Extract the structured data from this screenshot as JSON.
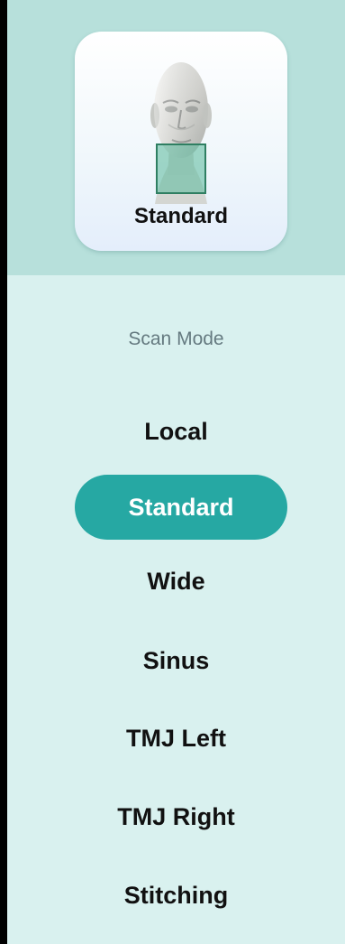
{
  "preview": {
    "label": "Standard",
    "image": "face-scan-preview"
  },
  "scan_mode": {
    "title": "Scan Mode",
    "selected": "Standard",
    "options": [
      "Local",
      "Standard",
      "Wide",
      "Sinus",
      "TMJ Left",
      "TMJ Right",
      "Stitching"
    ]
  },
  "colors": {
    "panel_background": "#d9f1ef",
    "header_background": "#b7e0db",
    "selected_background": "#26a8a3",
    "selected_text": "#ffffff",
    "scan_mode_title_text": "#657a80"
  }
}
